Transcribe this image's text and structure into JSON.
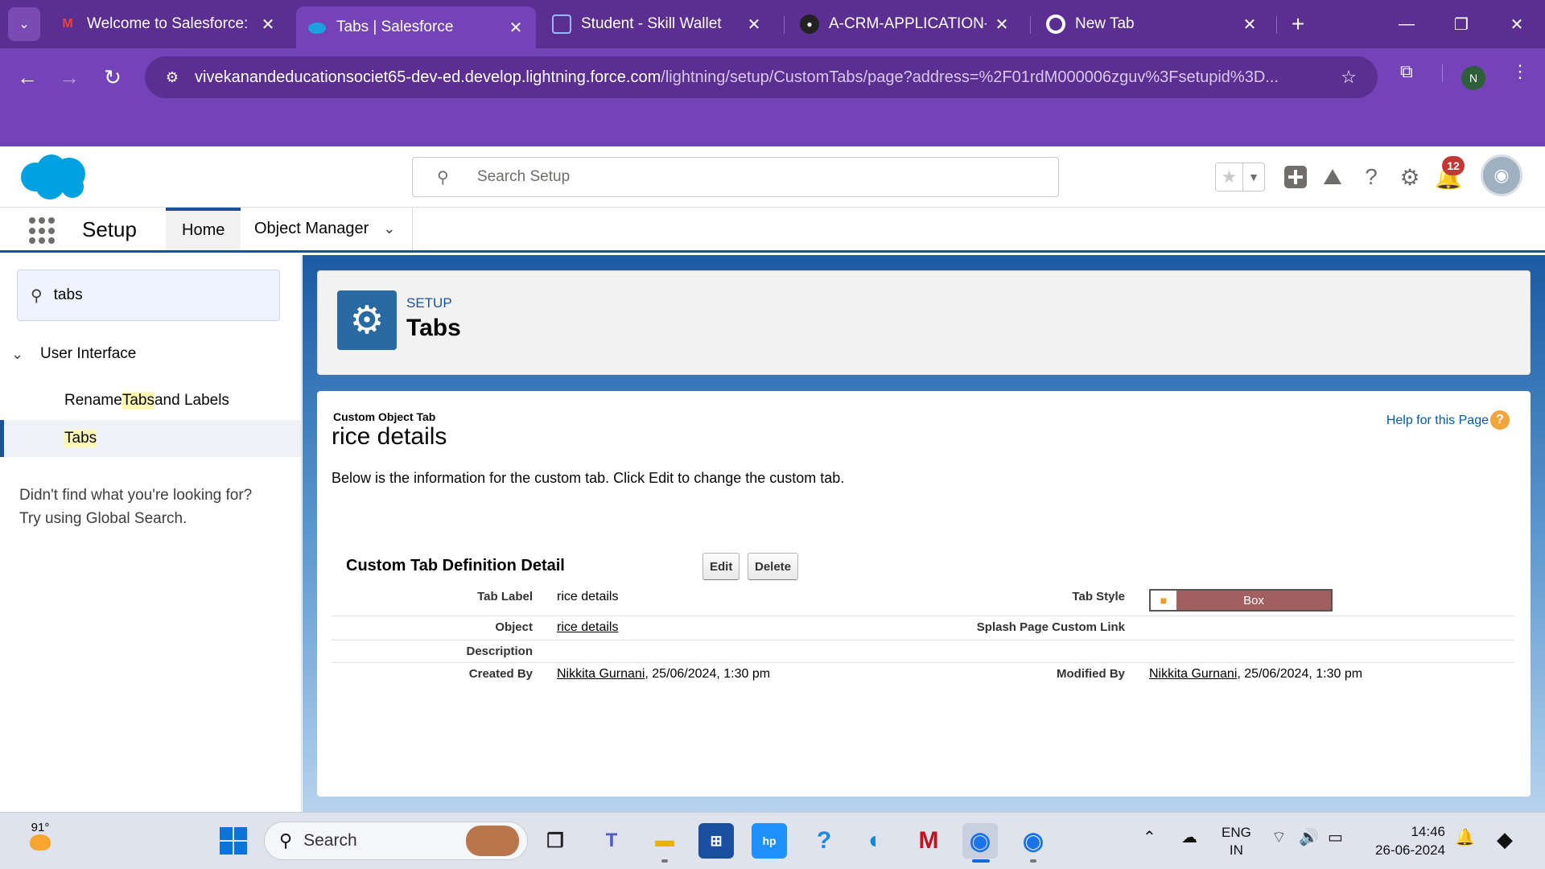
{
  "browser": {
    "tabs": [
      {
        "title": "Welcome to Salesforce: V",
        "icon": "gmail-icon",
        "active": false
      },
      {
        "title": "Tabs | Salesforce",
        "icon": "salesforce-cloud-icon",
        "active": true
      },
      {
        "title": "Student - Skill Wallet",
        "icon": "skill-wallet-icon",
        "active": false
      },
      {
        "title": "A-CRM-APPLICATION-FC",
        "icon": "github-icon",
        "active": false
      },
      {
        "title": "New Tab",
        "icon": "chrome-icon",
        "active": false
      }
    ],
    "url_host": "vivekanandeducationsociet65-dev-ed.develop.lightning.force.com",
    "url_path": "/lightning/setup/CustomTabs/page?address=%2F01rdM000006zguv%3Fsetupid%3D...",
    "profile_initial": "N"
  },
  "sf": {
    "search_placeholder": "Search Setup",
    "notification_count": "12",
    "app_name": "Setup",
    "nav": {
      "home": "Home",
      "object_manager": "Object Manager"
    },
    "brand_color": "#1b5297"
  },
  "sidebar": {
    "quickfind_value": "tabs",
    "section": "User Interface",
    "item1_pre": "Rename ",
    "item1_hl": "Tabs",
    "item1_post": " and Labels",
    "item2": "Tabs",
    "not_found_line1": "Didn't find what you're looking for?",
    "not_found_line2": "Try using Global Search."
  },
  "page": {
    "eyebrow": "SETUP",
    "title": "Tabs"
  },
  "content": {
    "type_label": "Custom Object Tab",
    "name": "rice details",
    "help_link": "Help for this Page",
    "description": "Below is the information for the custom tab. Click Edit to change the custom tab.",
    "section_title": "Custom Tab Definition Detail",
    "edit_btn": "Edit",
    "delete_btn": "Delete",
    "fields": {
      "tab_label_lbl": "Tab Label",
      "tab_label_val": "rice details",
      "tab_style_lbl": "Tab Style",
      "tab_style_val": "Box",
      "tab_style_color": "#a15f5f",
      "object_lbl": "Object",
      "object_val": "rice details",
      "splash_lbl": "Splash Page Custom Link",
      "description_lbl": "Description",
      "created_lbl": "Created By",
      "created_user": "Nikkita Gurnani",
      "created_date": ", 25/06/2024, 1:30 pm",
      "modified_lbl": "Modified By",
      "modified_user": "Nikkita Gurnani",
      "modified_date": ", 25/06/2024, 1:30 pm"
    }
  },
  "taskbar": {
    "temperature": "91°",
    "search_label": "Search",
    "lang_line1": "ENG",
    "lang_line2": "IN",
    "time": "14:46",
    "date": "26-06-2024"
  }
}
